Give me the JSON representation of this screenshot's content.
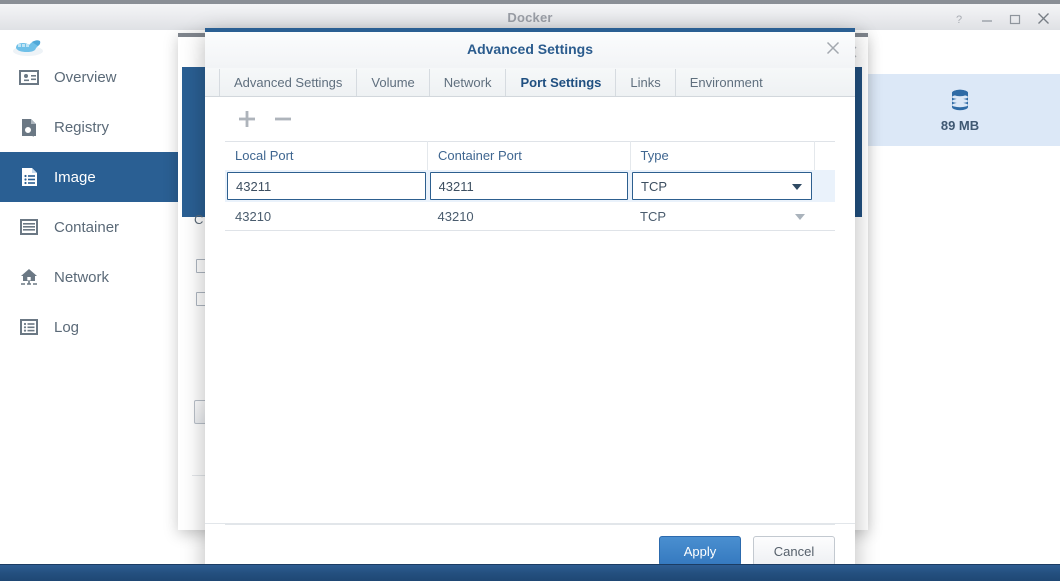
{
  "window": {
    "title": "Docker",
    "buttons": [
      {
        "name": "help-button",
        "glyph": "?"
      },
      {
        "name": "minimize-button",
        "glyph": "─"
      },
      {
        "name": "maximize-button",
        "glyph": "□"
      },
      {
        "name": "close-button",
        "glyph": "✕"
      }
    ]
  },
  "sidebar": {
    "logo": "docker-whale-logo",
    "items": [
      {
        "label": "Overview",
        "icon": "overview-icon",
        "active": false
      },
      {
        "label": "Registry",
        "icon": "registry-icon",
        "active": false
      },
      {
        "label": "Image",
        "icon": "image-icon",
        "active": true
      },
      {
        "label": "Container",
        "icon": "container-icon",
        "active": false
      },
      {
        "label": "Network",
        "icon": "network-icon",
        "active": false
      },
      {
        "label": "Log",
        "icon": "log-icon",
        "active": false
      }
    ]
  },
  "content": {
    "image_card": {
      "icon": "database-icon",
      "size": "89 MB"
    },
    "background_dialog": {
      "label": "C"
    }
  },
  "modal": {
    "title": "Advanced Settings",
    "close_icon": "close-icon",
    "tabs": [
      {
        "label": "Advanced Settings",
        "active": false
      },
      {
        "label": "Volume",
        "active": false
      },
      {
        "label": "Network",
        "active": false
      },
      {
        "label": "Port Settings",
        "active": true
      },
      {
        "label": "Links",
        "active": false
      },
      {
        "label": "Environment",
        "active": false
      }
    ],
    "toolbar": {
      "add_icon": "plus-icon",
      "remove_icon": "minus-icon"
    },
    "table": {
      "columns": [
        "Local Port",
        "Container Port",
        "Type"
      ],
      "rows": [
        {
          "local_port": "43211",
          "container_port": "43211",
          "type": "TCP",
          "editing": true
        },
        {
          "local_port": "43210",
          "container_port": "43210",
          "type": "TCP",
          "editing": false
        }
      ]
    },
    "footer": {
      "apply_label": "Apply",
      "cancel_label": "Cancel"
    }
  },
  "colors": {
    "accent": "#2a5f93",
    "primary_button": "#3579bf",
    "active_nav": "#2a5f93",
    "card_background": "#dce8f7",
    "taskbar": "#24507f"
  }
}
